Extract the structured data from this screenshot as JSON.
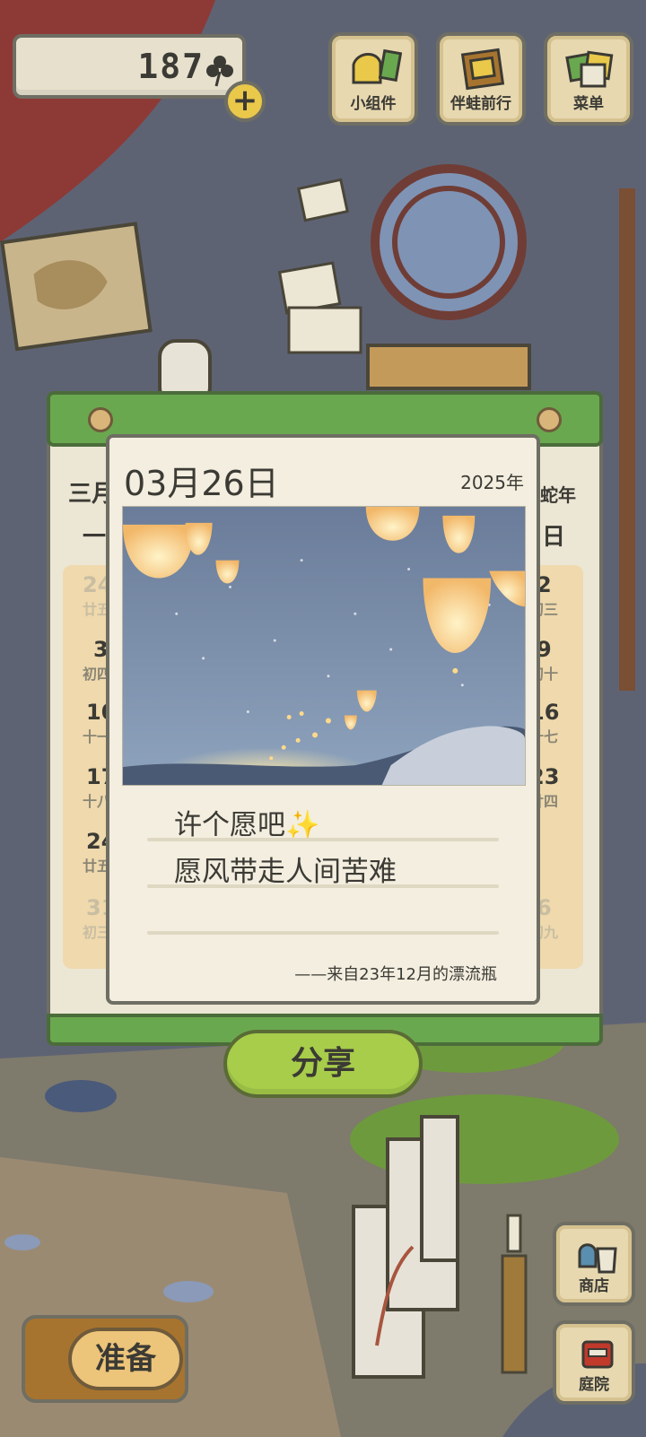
{
  "header": {
    "clover_count": "187",
    "clover_icon": "clover-icon",
    "plus_icon": "plus-icon"
  },
  "top_buttons": [
    {
      "label": "小组件",
      "icon": "widget-icon"
    },
    {
      "label": "伴蛙前行",
      "icon": "frog-companion-icon"
    },
    {
      "label": "菜单",
      "icon": "menu-icon"
    }
  ],
  "calendar": {
    "month_partial": "三月",
    "year_partial": "蛇年",
    "weekday_left": "一",
    "weekday_right": "日",
    "left_column": [
      {
        "day": "24",
        "lunar": "廿五"
      },
      {
        "day": "3",
        "lunar": "初四"
      },
      {
        "day": "10",
        "lunar": "十一"
      },
      {
        "day": "17",
        "lunar": "十八"
      },
      {
        "day": "24",
        "lunar": "廿五"
      },
      {
        "day": "31",
        "lunar": "初三"
      }
    ],
    "right_column": [
      {
        "day": "2",
        "lunar": "初三"
      },
      {
        "day": "9",
        "lunar": "初十"
      },
      {
        "day": "16",
        "lunar": "十七"
      },
      {
        "day": "23",
        "lunar": "廿四"
      },
      {
        "day": "",
        "lunar": ""
      },
      {
        "day": "6",
        "lunar": "初九"
      }
    ]
  },
  "card": {
    "date": "03月26日",
    "year": "2025年",
    "line1": "许个愿吧✨",
    "line2": "愿风带走人间苦难",
    "footer": "——来自23年12月的漂流瓶"
  },
  "share_label": "分享",
  "bottom": {
    "prepare_label": "准备",
    "shop_label": "商店",
    "yard_label": "庭院",
    "shop_icon": "shop-bag-icon",
    "yard_icon": "mailbox-icon"
  },
  "colors": {
    "green": "#6aa84f",
    "share_green": "#a7cd4a",
    "card_bg": "#f3eedf",
    "text": "#3b3a34"
  }
}
